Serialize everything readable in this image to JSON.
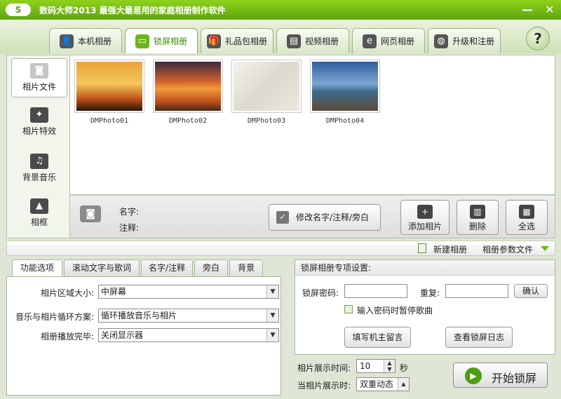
{
  "app": {
    "logo_text": "S",
    "title": "数码大师2013   最强大最易用的家庭相册制作软件",
    "minimize": "—",
    "close": "✕"
  },
  "tabs": [
    {
      "label": "本机相册",
      "icon": "person-photo-icon",
      "glyph": "👤"
    },
    {
      "label": "锁屏相册",
      "icon": "monitor-icon",
      "glyph": "▭"
    },
    {
      "label": "礼品包相册",
      "icon": "gift-icon",
      "glyph": "🎁"
    },
    {
      "label": "视频相册",
      "icon": "film-icon",
      "glyph": "▤"
    },
    {
      "label": "网页相册",
      "icon": "browser-e-icon",
      "glyph": "e"
    },
    {
      "label": "升级和注册",
      "icon": "globe-icon",
      "glyph": "◍"
    }
  ],
  "help": "?",
  "sidebar": {
    "items": [
      {
        "label": "相片文件",
        "icon": "camera-icon",
        "glyph": "◙"
      },
      {
        "label": "相片特效",
        "icon": "effects-icon",
        "glyph": "✦"
      },
      {
        "label": "背景音乐",
        "icon": "music-note-icon",
        "glyph": "♫"
      },
      {
        "label": "相框",
        "icon": "frame-icon",
        "glyph": "▲"
      }
    ]
  },
  "photos": [
    {
      "caption": "DMPhoto01"
    },
    {
      "caption": "DMPhoto02"
    },
    {
      "caption": "DMPhoto03"
    },
    {
      "caption": "DMPhoto04"
    }
  ],
  "info": {
    "name_label": "名字:",
    "note_label": "注释:",
    "edit_button": "修改名字/注释/旁白",
    "add_photo": "添加相片",
    "delete": "删除",
    "select_all": "全选"
  },
  "strip": {
    "new_album": "新建相册",
    "album_params": "相册参数文件"
  },
  "subtabs": [
    "功能选项",
    "滚动文字与歌词",
    "名字/注释",
    "旁白",
    "背景"
  ],
  "options": {
    "area_label": "相片区域大小:",
    "area_value": "中屏幕",
    "loop_label": "音乐与相片循环方案:",
    "loop_value": "循环播放音乐与相片",
    "end_label": "相册播放完毕:",
    "end_value": "关闭显示器"
  },
  "lock": {
    "header": "锁屏相册专项设置:",
    "password_label": "锁屏密码:",
    "repeat_label": "重复:",
    "confirm": "确认",
    "pause_music": "输入密码时暂停歌曲",
    "leave_message": "填写机主留言",
    "view_log": "查看锁屏日志"
  },
  "display": {
    "time_label": "相片展示时间:",
    "time_value": "10",
    "time_unit": "秒",
    "when_label": "当相片展示时:",
    "when_value": "双重动态"
  },
  "start": "开始锁屏"
}
